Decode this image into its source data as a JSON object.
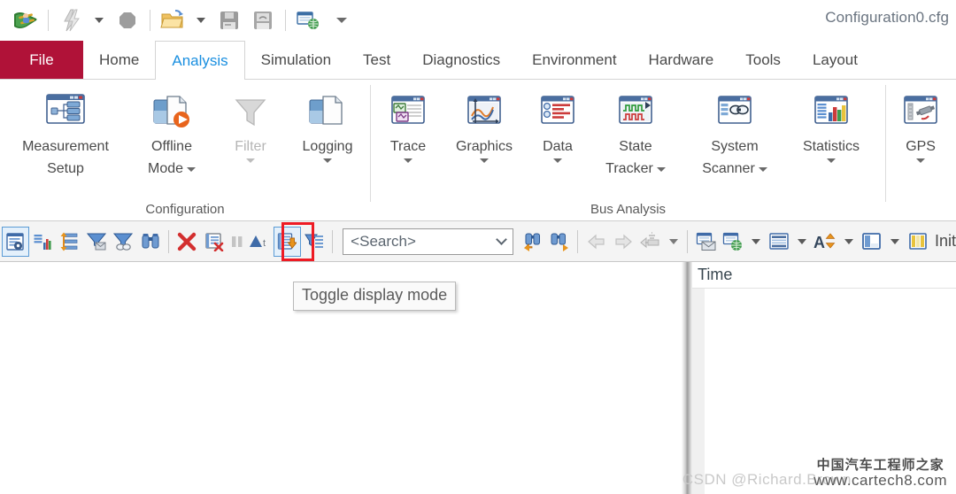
{
  "window": {
    "title": "Configuration0.cfg"
  },
  "quick_access": [
    {
      "name": "canoe-app-icon",
      "glyph": "canoe"
    },
    {
      "name": "separator-1",
      "glyph": "sep"
    },
    {
      "name": "flash-icon",
      "glyph": "flash"
    },
    {
      "name": "flash-dropdown",
      "glyph": "caret"
    },
    {
      "name": "stop-icon",
      "glyph": "stop"
    },
    {
      "name": "separator-2",
      "glyph": "sep"
    },
    {
      "name": "open-folder-icon",
      "glyph": "openfolder"
    },
    {
      "name": "open-dropdown",
      "glyph": "caret"
    },
    {
      "name": "save-icon",
      "glyph": "save"
    },
    {
      "name": "save-as-icon",
      "glyph": "saveas"
    },
    {
      "name": "separator-3",
      "glyph": "sep"
    },
    {
      "name": "publish-web-icon",
      "glyph": "webfolder"
    },
    {
      "name": "customize-qat-dropdown",
      "glyph": "caret-thin"
    }
  ],
  "tabs": [
    {
      "label": "File",
      "active": false,
      "file": true
    },
    {
      "label": "Home",
      "active": false
    },
    {
      "label": "Analysis",
      "active": true
    },
    {
      "label": "Simulation",
      "active": false
    },
    {
      "label": "Test",
      "active": false
    },
    {
      "label": "Diagnostics",
      "active": false
    },
    {
      "label": "Environment",
      "active": false
    },
    {
      "label": "Hardware",
      "active": false
    },
    {
      "label": "Tools",
      "active": false
    },
    {
      "label": "Layout",
      "active": false
    }
  ],
  "ribbon": {
    "groups": [
      {
        "label": "Configuration",
        "items": [
          {
            "name": "measurement-setup",
            "line1": "Measurement",
            "line2": "Setup",
            "icon": "measurement-setup-icon",
            "dropdown": false,
            "disabled": false
          },
          {
            "name": "offline-mode",
            "line1": "Offline",
            "line2": "Mode",
            "icon": "offline-mode-icon",
            "dropdown": true,
            "dropdown_inline": true,
            "disabled": false
          },
          {
            "name": "filter",
            "line1": "Filter",
            "line2": "",
            "icon": "filter-funnel-icon",
            "dropdown": true,
            "disabled": true
          },
          {
            "name": "logging",
            "line1": "Logging",
            "line2": "",
            "icon": "logging-icon",
            "dropdown": true,
            "disabled": false
          }
        ]
      },
      {
        "label": "Bus Analysis",
        "items": [
          {
            "name": "trace",
            "line1": "Trace",
            "line2": "",
            "icon": "trace-window-icon",
            "dropdown": true,
            "disabled": false
          },
          {
            "name": "graphics",
            "line1": "Graphics",
            "line2": "",
            "icon": "graphics-window-icon",
            "dropdown": true,
            "disabled": false
          },
          {
            "name": "data",
            "line1": "Data",
            "line2": "",
            "icon": "data-window-icon",
            "dropdown": true,
            "disabled": false
          },
          {
            "name": "state-tracker",
            "line1": "State",
            "line2": "Tracker",
            "icon": "state-tracker-icon",
            "dropdown": true,
            "dropdown_inline": true,
            "disabled": false
          },
          {
            "name": "system-scanner",
            "line1": "System",
            "line2": "Scanner",
            "icon": "system-scanner-icon",
            "dropdown": true,
            "dropdown_inline": true,
            "disabled": false
          },
          {
            "name": "statistics",
            "line1": "Statistics",
            "line2": "",
            "icon": "statistics-window-icon",
            "dropdown": true,
            "disabled": false
          }
        ]
      },
      {
        "label": "",
        "items": [
          {
            "name": "gps",
            "line1": "GPS",
            "line2": "",
            "icon": "gps-satellite-icon",
            "dropdown": true,
            "disabled": false
          }
        ]
      }
    ]
  },
  "toolbar": {
    "buttons": [
      {
        "name": "trace-config-button",
        "icon": "trace-config-icon",
        "selected": true
      },
      {
        "name": "statistics-button",
        "icon": "bar-stats-icon",
        "selected": false
      },
      {
        "name": "expand-collapse-button",
        "icon": "expand-rows-icon",
        "selected": false
      },
      {
        "name": "filter-messages-button",
        "icon": "funnel-mail-icon",
        "selected": false
      },
      {
        "name": "filter-clear-button",
        "icon": "funnel-clear-icon",
        "selected": false
      },
      {
        "name": "search-button",
        "icon": "binoculars-icon",
        "selected": false
      },
      {
        "name": "separator-a",
        "icon": "sep",
        "selected": false
      },
      {
        "name": "clear-all-button",
        "icon": "red-x-icon",
        "selected": false
      },
      {
        "name": "clear-window-button",
        "icon": "clear-window-icon",
        "selected": false
      },
      {
        "name": "pause-button",
        "icon": "pause-icon",
        "selected": false
      },
      {
        "name": "marker-button",
        "icon": "marker-triangle-icon",
        "selected": false
      },
      {
        "name": "toggle-display-mode-button",
        "icon": "toggle-display-mode-icon",
        "selected": true,
        "highlighted": true
      },
      {
        "name": "column-filter-button",
        "icon": "funnel-lines-icon",
        "selected": false
      },
      {
        "name": "separator-b",
        "icon": "sep",
        "selected": false
      }
    ],
    "search": {
      "value": "<Search>",
      "placeholder": "<Search>"
    },
    "buttons_right": [
      {
        "name": "find-previous-button",
        "icon": "binoculars-prev-icon"
      },
      {
        "name": "find-next-button",
        "icon": "binoculars-next-icon"
      },
      {
        "name": "separator-c",
        "icon": "sep"
      },
      {
        "name": "navigate-back-button",
        "icon": "arrow-back-icon",
        "disabled": true
      },
      {
        "name": "navigate-forward-button",
        "icon": "arrow-forward-icon",
        "disabled": true
      },
      {
        "name": "goto-marker-button",
        "icon": "goto-marker-icon",
        "disabled": true
      },
      {
        "name": "goto-marker-dropdown",
        "icon": "caret"
      },
      {
        "name": "separator-d",
        "icon": "sep"
      },
      {
        "name": "export-mail-button",
        "icon": "export-mail-icon"
      },
      {
        "name": "export-web-button",
        "icon": "export-web-icon"
      },
      {
        "name": "export-web-dropdown",
        "icon": "caret"
      },
      {
        "name": "line-spacing-button",
        "icon": "line-spacing-icon"
      },
      {
        "name": "line-spacing-dropdown",
        "icon": "caret"
      },
      {
        "name": "font-size-button",
        "icon": "font-size-icon"
      },
      {
        "name": "font-size-dropdown",
        "icon": "caret"
      },
      {
        "name": "panel-layout-button",
        "icon": "panel-layout-icon"
      },
      {
        "name": "panel-layout-dropdown",
        "icon": "caret"
      },
      {
        "name": "columns-button",
        "icon": "columns-icon"
      }
    ],
    "trailing_label": "Init"
  },
  "tooltip": {
    "text": "Toggle display mode"
  },
  "right_pane": {
    "column_header": "Time"
  },
  "watermark": {
    "chinese": "中国汽车工程师之家",
    "url": "www.cartech8.com",
    "csdn": "CSDN @Richard.Brown"
  },
  "colors": {
    "file_tab": "#b01238",
    "active_tab_text": "#1a8fe0",
    "highlight_box": "#ee1b24",
    "selected_button_border": "#5b9bd5"
  }
}
